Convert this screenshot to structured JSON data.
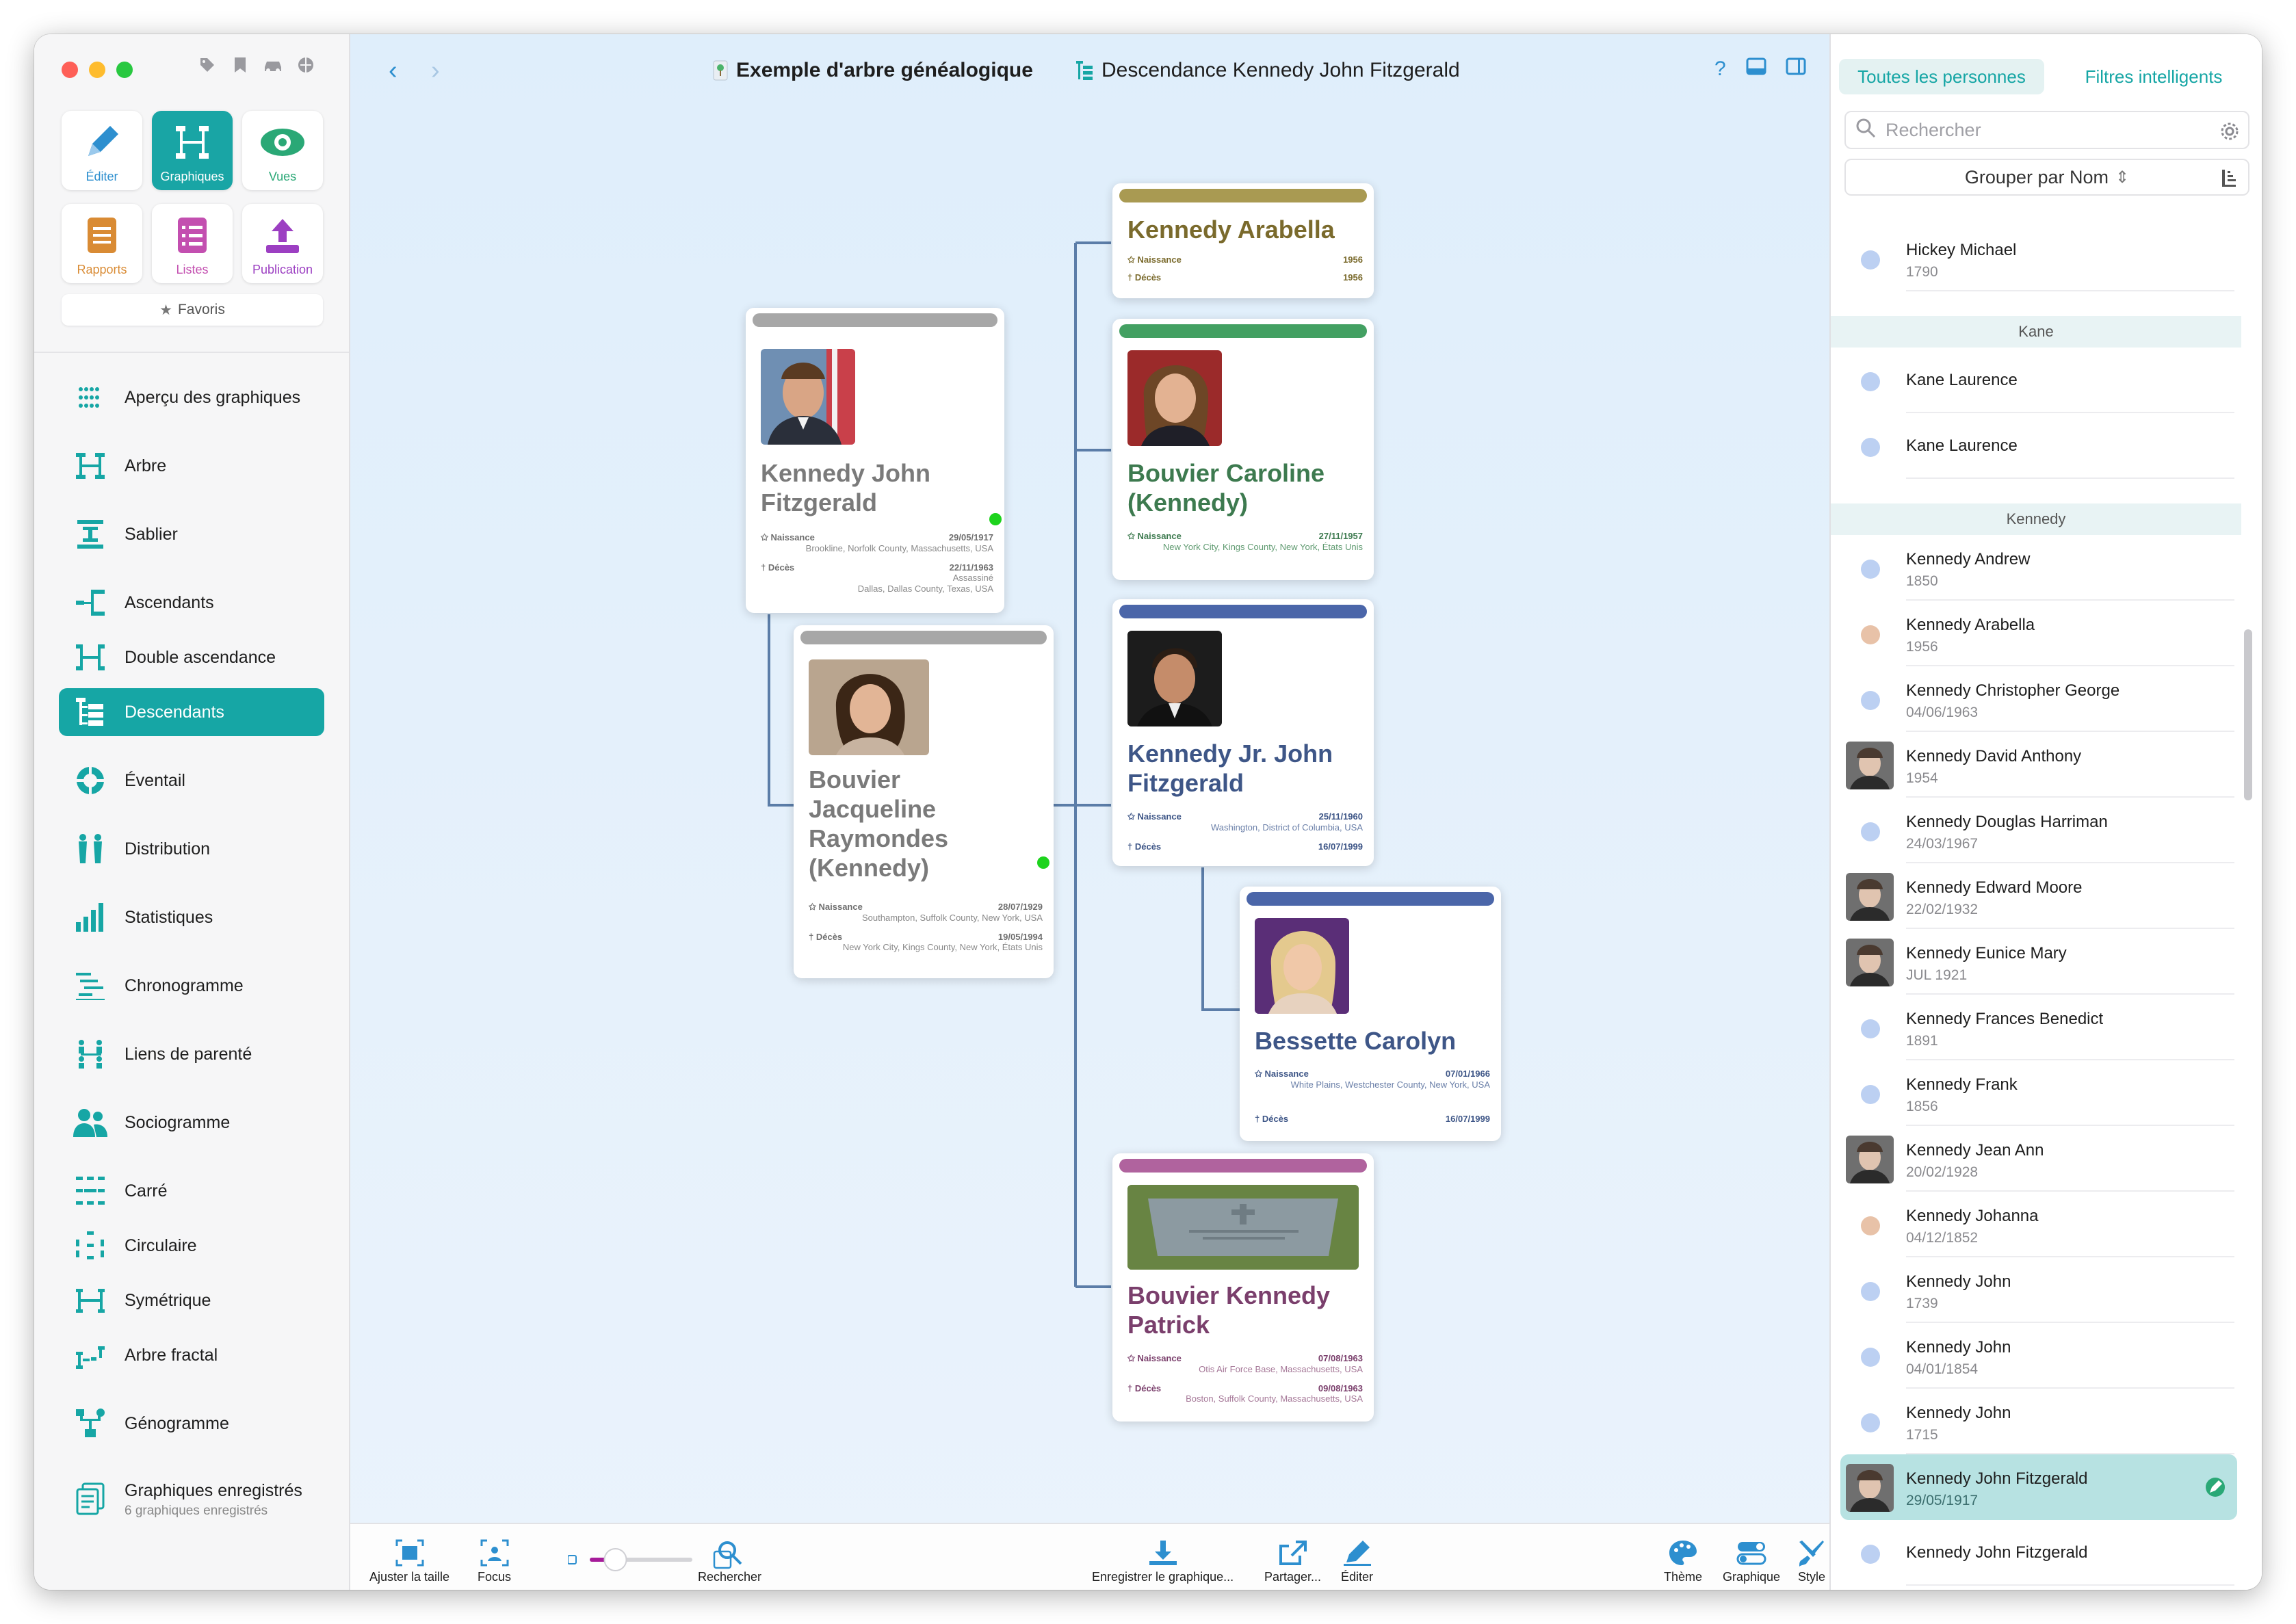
{
  "window": {
    "title": "Exemple d'arbre généalogique",
    "subtitle": "Descendance Kennedy John Fitzgerald"
  },
  "sidebar": {
    "tiles": [
      {
        "label": "Éditer",
        "icon": "pencil-icon",
        "color": "#2d8fcf"
      },
      {
        "label": "Graphiques",
        "icon": "chart-tree-icon",
        "color": "#ffffff"
      },
      {
        "label": "Vues",
        "icon": "eye-icon",
        "color": "#2aa876"
      },
      {
        "label": "Rapports",
        "icon": "report-icon",
        "color": "#d98b34"
      },
      {
        "label": "Listes",
        "icon": "list-icon",
        "color": "#c34fb0"
      },
      {
        "label": "Publication",
        "icon": "upload-icon",
        "color": "#9c3fc2"
      }
    ],
    "favoris": "Favoris",
    "items": [
      {
        "label": "Aperçu des graphiques",
        "icon": "grid-dots-icon"
      },
      {
        "label": "Arbre",
        "icon": "tree-icon"
      },
      {
        "label": "Sablier",
        "icon": "hourglass-icon"
      },
      {
        "label": "Ascendants",
        "icon": "ancestors-icon"
      },
      {
        "label": "Double ascendance",
        "icon": "double-ancestry-icon"
      },
      {
        "label": "Descendants",
        "icon": "descendants-icon"
      },
      {
        "label": "Éventail",
        "icon": "fan-icon"
      },
      {
        "label": "Distribution",
        "icon": "distribution-icon"
      },
      {
        "label": "Statistiques",
        "icon": "bar-chart-icon"
      },
      {
        "label": "Chronogramme",
        "icon": "timeline-icon"
      },
      {
        "label": "Liens de parenté",
        "icon": "relationship-icon"
      },
      {
        "label": "Sociogramme",
        "icon": "people-icon"
      },
      {
        "label": "Carré",
        "icon": "square-chart-icon"
      },
      {
        "label": "Circulaire",
        "icon": "circular-chart-icon"
      },
      {
        "label": "Symétrique",
        "icon": "symmetric-chart-icon"
      },
      {
        "label": "Arbre fractal",
        "icon": "fractal-tree-icon"
      },
      {
        "label": "Génogramme",
        "icon": "genogram-icon"
      },
      {
        "label": "Graphiques enregistrés",
        "sub": "6 graphiques enregistrés",
        "icon": "saved-charts-icon"
      }
    ]
  },
  "cards": [
    {
      "id": "jfk",
      "name_lines": [
        "Kennedy John",
        "Fitzgerald"
      ],
      "color": "#7a7a7a",
      "bar": "#a7a7a7",
      "birth_label": "Naissance",
      "birth_date": "29/05/1917",
      "birth_place": "Brookline, Norfolk County, Massachusetts, USA",
      "death_label": "Décès",
      "death_date": "22/11/1963",
      "death_note": "Assassiné",
      "death_place": "Dallas, Dallas County, Texas, USA"
    },
    {
      "id": "jackie",
      "name_lines": [
        "Bouvier",
        "Jacqueline",
        "Raymondes",
        "(Kennedy)"
      ],
      "color": "#7a7a7a",
      "bar": "#a7a7a7",
      "birth_label": "Naissance",
      "birth_date": "28/07/1929",
      "birth_place": "Southampton, Suffolk County, New York, USA",
      "death_label": "Décès",
      "death_date": "19/05/1994",
      "death_place": "New York City, Kings County, New York, États Unis"
    },
    {
      "id": "arabella",
      "name_lines": [
        "Kennedy Arabella"
      ],
      "color": "#7a6a2c",
      "bar": "#a99a52",
      "birth_label": "Naissance",
      "birth_date": "1956",
      "death_label": "Décès",
      "death_date": "1956"
    },
    {
      "id": "caroline",
      "name_lines": [
        "Bouvier Caroline",
        "(Kennedy)"
      ],
      "color": "#3d7a4f",
      "bar": "#43a062",
      "birth_label": "Naissance",
      "birth_date": "27/11/1957",
      "birth_place": "New York City, Kings County, New York, États Unis"
    },
    {
      "id": "jfkjr",
      "name_lines": [
        "Kennedy Jr. John",
        "Fitzgerald"
      ],
      "color": "#3e5687",
      "bar": "#4b66a9",
      "birth_label": "Naissance",
      "birth_date": "25/11/1960",
      "birth_place": "Washington, District of Columbia, USA",
      "death_label": "Décès",
      "death_date": "16/07/1999"
    },
    {
      "id": "carolyn",
      "name_lines": [
        "Bessette Carolyn"
      ],
      "color": "#3e5687",
      "bar": "#4b66a9",
      "birth_label": "Naissance",
      "birth_date": "07/01/1966",
      "birth_place": "White Plains, Westchester County, New York, USA",
      "death_label": "Décès",
      "death_date": "16/07/1999"
    },
    {
      "id": "patrick",
      "name_lines": [
        "Bouvier Kennedy",
        "Patrick"
      ],
      "color": "#7a3f6c",
      "bar": "#b0639e",
      "birth_label": "Naissance",
      "birth_date": "07/08/1963",
      "birth_place": "Otis Air Force Base, Massachusetts, USA",
      "death_label": "Décès",
      "death_date": "09/08/1963",
      "death_place": "Boston, Suffolk County, Massachusetts, USA"
    }
  ],
  "bottombar": {
    "fit": "Ajuster la taille",
    "focus": "Focus",
    "search": "Rechercher",
    "save": "Enregistrer le graphique...",
    "share": "Partager...",
    "edit": "Éditer",
    "theme": "Thème",
    "graph": "Graphique",
    "style": "Style",
    "zoom_level": 0.25
  },
  "rightpanel": {
    "tab_all": "Toutes les personnes",
    "tab_smart": "Filtres intelligents",
    "search_placeholder": "Rechercher",
    "group_by": "Grouper par Nom",
    "rows": [
      {
        "type": "person",
        "name": "Hickey Michael",
        "date": "1790",
        "dot": "#bcd0f2"
      },
      {
        "type": "section",
        "name": "Kane"
      },
      {
        "type": "person",
        "name": "Kane Laurence",
        "date": "",
        "dot": "#bcd0f2"
      },
      {
        "type": "person",
        "name": "Kane Laurence",
        "date": "",
        "dot": "#bcd0f2"
      },
      {
        "type": "section",
        "name": "Kennedy"
      },
      {
        "type": "person",
        "name": "Kennedy Andrew",
        "date": "1850",
        "dot": "#bcd0f2"
      },
      {
        "type": "person",
        "name": "Kennedy Arabella",
        "date": "1956",
        "dot": "#e8c2a8"
      },
      {
        "type": "person",
        "name": "Kennedy Christopher George",
        "date": "04/06/1963",
        "dot": "#bcd0f2"
      },
      {
        "type": "person",
        "name": "Kennedy David Anthony",
        "date": "1954",
        "thumb": true
      },
      {
        "type": "person",
        "name": "Kennedy Douglas Harriman",
        "date": "24/03/1967",
        "dot": "#bcd0f2"
      },
      {
        "type": "person",
        "name": "Kennedy Edward Moore",
        "date": "22/02/1932",
        "thumb": true
      },
      {
        "type": "person",
        "name": "Kennedy Eunice Mary",
        "date": "JUL 1921",
        "thumb": true
      },
      {
        "type": "person",
        "name": "Kennedy Frances Benedict",
        "date": "1891",
        "dot": "#bcd0f2"
      },
      {
        "type": "person",
        "name": "Kennedy Frank",
        "date": "1856",
        "dot": "#bcd0f2"
      },
      {
        "type": "person",
        "name": "Kennedy Jean Ann",
        "date": "20/02/1928",
        "thumb": true
      },
      {
        "type": "person",
        "name": "Kennedy Johanna",
        "date": "04/12/1852",
        "dot": "#e8c2a8"
      },
      {
        "type": "person",
        "name": "Kennedy John",
        "date": "1739",
        "dot": "#bcd0f2"
      },
      {
        "type": "person",
        "name": "Kennedy John",
        "date": "04/01/1854",
        "dot": "#bcd0f2"
      },
      {
        "type": "person",
        "name": "Kennedy John",
        "date": "1715",
        "dot": "#bcd0f2"
      },
      {
        "type": "person",
        "name": "Kennedy John Fitzgerald",
        "date": "29/05/1917",
        "thumb": true,
        "selected": true
      },
      {
        "type": "person",
        "name": "Kennedy John Fitzgerald",
        "date": "",
        "dot": "#bcd0f2"
      }
    ]
  },
  "accent": "#16a6a5"
}
